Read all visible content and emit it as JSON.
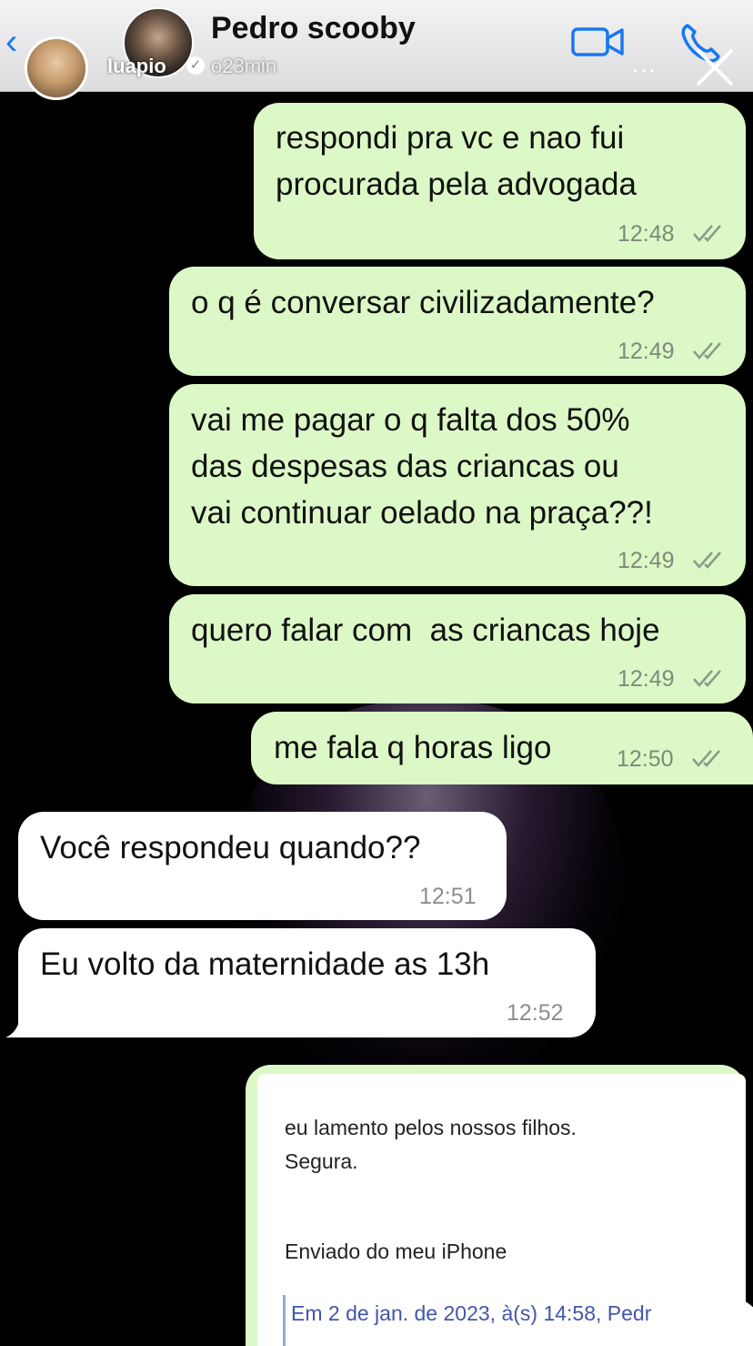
{
  "header": {
    "back_glyph": "‹",
    "title": "Pedro scooby",
    "story_user": "luapio",
    "story_time": "o23min",
    "more_glyph": "...",
    "icons": [
      "back-icon",
      "video-call-icon",
      "phone-icon",
      "close-icon",
      "verified-icon"
    ],
    "accent_color": "#1877f2"
  },
  "messages": [
    {
      "direction": "out",
      "lines": "respondi pra vc e nao fui\nprocurada pela advogada",
      "time": "12:48",
      "status": "read"
    },
    {
      "direction": "out",
      "lines": "o q é conversar civilizadamente?",
      "time": "12:49",
      "status": "read"
    },
    {
      "direction": "out",
      "lines": "vai me pagar o q falta dos 50%\ndas despesas das criancas ou\nvai continuar oelado na praça??!",
      "time": "12:49",
      "status": "read"
    },
    {
      "direction": "out",
      "lines": "quero falar com  as criancas hoje",
      "time": "12:49",
      "status": "read"
    },
    {
      "direction": "out",
      "lines": "me fala q horas ligo",
      "time": "12:50",
      "status": "read"
    },
    {
      "direction": "in",
      "lines": "Você respondeu quando??",
      "time": "12:51"
    },
    {
      "direction": "in",
      "lines": "Eu volto da maternidade as 13h",
      "time": "12:52"
    }
  ],
  "email_card": {
    "line1": "eu lamento pelos nossos filhos.",
    "line2": "Segura.",
    "signature": "Enviado do meu iPhone",
    "quote": "Em 2 de jan. de 2023, à(s) 14:58, Pedr"
  },
  "colors": {
    "outgoing_bubble": "#dcf8c6",
    "incoming_bubble": "#ffffff",
    "background": "#000000",
    "read_ticks": "#8a9a88"
  }
}
